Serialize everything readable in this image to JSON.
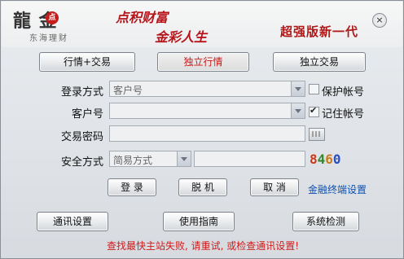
{
  "header": {
    "logo_main": "龍 金",
    "logo_badge": "点",
    "logo_sub": "东海理财",
    "slogan_line1": "点积财富",
    "slogan_line2": "金彩人生",
    "edition": "超强版新一代",
    "close_icon": "×"
  },
  "mode_tabs": [
    {
      "label": "行情+交易"
    },
    {
      "label": "独立行情"
    },
    {
      "label": "独立交易"
    }
  ],
  "form": {
    "login_mode": {
      "label": "登录方式",
      "value": "客户号"
    },
    "account": {
      "label": "客户号",
      "value": ""
    },
    "password": {
      "label": "交易密码",
      "value": ""
    },
    "security": {
      "label": "安全方式",
      "value": "简易方式",
      "code_value": ""
    },
    "save_account": {
      "label": "保护帐号",
      "checked": false
    },
    "remember_account": {
      "label": "记住帐号",
      "checked": true
    },
    "captcha": [
      "8",
      "4",
      "6",
      "0"
    ]
  },
  "actions": {
    "login": "登 录",
    "offline": "脱 机",
    "cancel": "取 消",
    "terminal_settings": "金融终端设置"
  },
  "footer": {
    "comm_settings": "通讯设置",
    "guide": "使用指南",
    "system_check": "系统检测",
    "status": "查找最快主站失败, 请重试, 或检查通讯设置!"
  },
  "colors": {
    "accent_red": "#c81b1b",
    "link_blue": "#0b4fb2"
  }
}
